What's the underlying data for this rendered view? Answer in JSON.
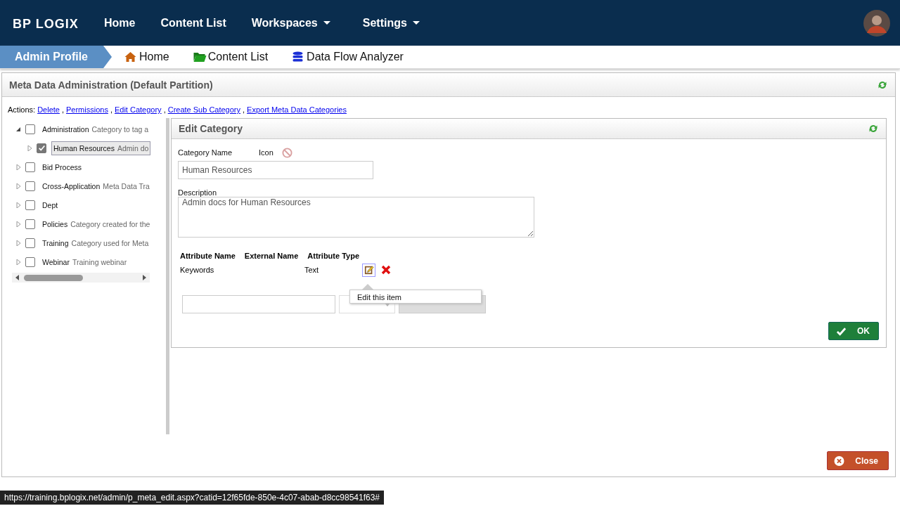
{
  "brand": {
    "logo": "BP LOGIX"
  },
  "nav": [
    {
      "label": "Home",
      "dropdown": false
    },
    {
      "label": "Content List",
      "dropdown": false
    },
    {
      "label": "Workspaces",
      "dropdown": true
    },
    {
      "label": "Settings",
      "dropdown": true
    }
  ],
  "breadcrumb": [
    {
      "label": "Admin Profile",
      "kind": "current"
    },
    {
      "label": "Home",
      "kind": "home"
    },
    {
      "label": "Content List",
      "kind": "folder"
    },
    {
      "label": "Data Flow Analyzer",
      "kind": "database"
    }
  ],
  "panel": {
    "title": "Meta Data Administration (Default Partition)"
  },
  "actions": {
    "label": "Actions:",
    "separator": ",",
    "links": [
      "Delete",
      "Permissions",
      "Edit Category",
      "Create Sub Category",
      "Export Meta Data Categories"
    ]
  },
  "tree": [
    {
      "name": "Administration",
      "description": "Category to tag a",
      "expanded": true,
      "checked": false,
      "selected": false,
      "children": [
        {
          "name": "Human Resources",
          "description": "Admin do",
          "expanded": false,
          "checked": true,
          "selected": true
        }
      ]
    },
    {
      "name": "Bid Process",
      "expanded": false,
      "checked": false,
      "selected": false
    },
    {
      "name": "Cross-Application",
      "description": "Meta Data Tra",
      "expanded": false,
      "checked": false,
      "selected": false
    },
    {
      "name": "Dept",
      "expanded": false,
      "checked": false,
      "selected": false
    },
    {
      "name": "Policies",
      "description": "Category created for the",
      "expanded": false,
      "checked": false,
      "selected": false
    },
    {
      "name": "Training",
      "description": "Category used for Meta",
      "expanded": false,
      "checked": false,
      "selected": false
    },
    {
      "name": "Webinar",
      "description": "Training webinar",
      "expanded": false,
      "checked": false,
      "selected": false
    }
  ],
  "edit": {
    "title": "Edit Category",
    "name_label": "Category Name",
    "icon_label": "Icon",
    "name_value": "Human Resources",
    "description_label": "Description",
    "description_value": "Admin docs for Human Resources",
    "columns": [
      "Attribute Name",
      "External Name",
      "Attribute Type"
    ],
    "attributes": [
      {
        "name": "Keywords",
        "type": "Text"
      }
    ],
    "tooltip": "Edit this item",
    "ok": "OK"
  },
  "close": "Close",
  "status_url": "https://training.bplogix.net/admin/p_meta_edit.aspx?catid=12f65fde-850e-4c07-abab-d8cc98541f63#"
}
